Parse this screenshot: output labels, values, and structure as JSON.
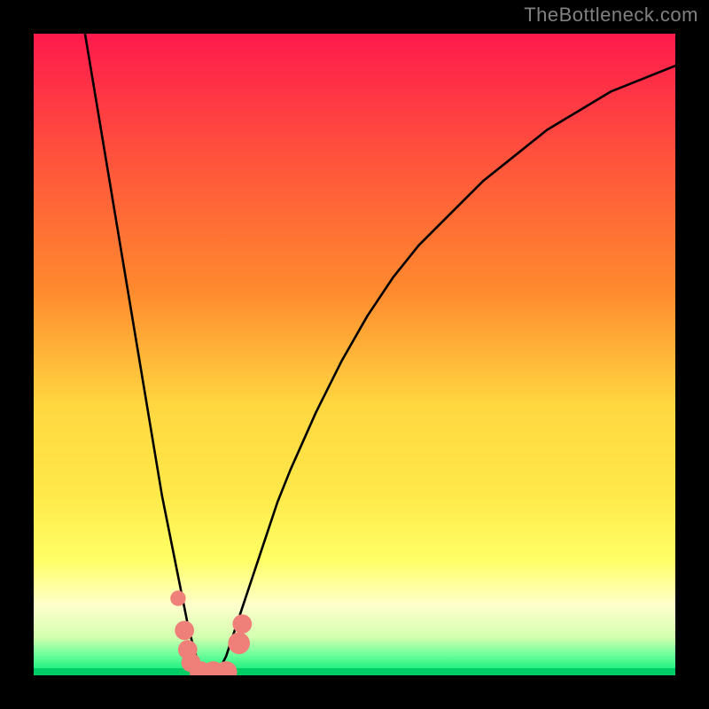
{
  "watermark": "TheBottleneck.com",
  "chart_data": {
    "type": "line",
    "title": "",
    "xlabel": "",
    "ylabel": "",
    "xlim": [
      0,
      100
    ],
    "ylim": [
      0,
      100
    ],
    "x_optimum": 27,
    "background_gradient": {
      "top": "#ff1a4d",
      "upper_mid": "#ff8a2e",
      "mid": "#ffd740",
      "lower_mid": "#ffff66",
      "pale": "#ffffcc",
      "bottom": "#00e673",
      "baseline_band": "#00cc66"
    },
    "series": [
      {
        "name": "bottleneck-curve",
        "color": "#000000",
        "x": [
          8,
          10,
          12,
          14,
          16,
          18,
          20,
          22,
          24,
          25,
          26,
          27,
          28,
          29,
          30,
          31,
          32,
          34,
          36,
          38,
          40,
          44,
          48,
          52,
          56,
          60,
          65,
          70,
          75,
          80,
          85,
          90,
          95,
          100
        ],
        "y": [
          100,
          88,
          76,
          64,
          52,
          40,
          28,
          18,
          8,
          4,
          1,
          0,
          0,
          1,
          3,
          6,
          9,
          15,
          21,
          27,
          32,
          41,
          49,
          56,
          62,
          67,
          72,
          77,
          81,
          85,
          88,
          91,
          93,
          95
        ]
      }
    ],
    "markers": {
      "name": "highlight-dots",
      "color": "#ef8079",
      "points": [
        {
          "x": 22.5,
          "y": 12,
          "r": 1.2
        },
        {
          "x": 23.5,
          "y": 7,
          "r": 1.5
        },
        {
          "x": 24.0,
          "y": 4,
          "r": 1.5
        },
        {
          "x": 24.5,
          "y": 2,
          "r": 1.5
        },
        {
          "x": 26.0,
          "y": 0.5,
          "r": 1.7
        },
        {
          "x": 28.0,
          "y": 0.5,
          "r": 1.7
        },
        {
          "x": 30.0,
          "y": 0.5,
          "r": 1.7
        },
        {
          "x": 32.0,
          "y": 5,
          "r": 1.7
        },
        {
          "x": 32.5,
          "y": 8,
          "r": 1.5
        }
      ]
    }
  }
}
